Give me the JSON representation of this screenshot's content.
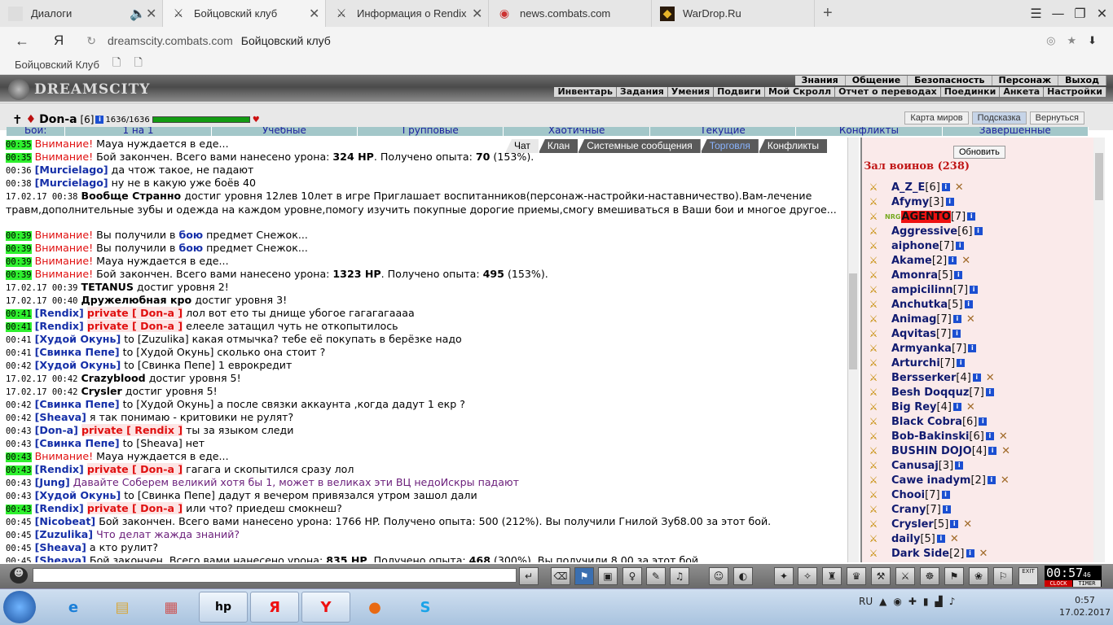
{
  "browser": {
    "tabs": [
      {
        "label": "Диалоги",
        "icon": "tab-icon",
        "closable": true,
        "extra": "speaker-icon"
      },
      {
        "label": "Бойцовский клуб",
        "icon": "crossed-swords-icon",
        "closable": true,
        "active": true
      },
      {
        "label": "Информация о Rendix",
        "icon": "crossed-swords-icon",
        "closable": true
      },
      {
        "label": "news.combats.com",
        "icon": "combats-icon",
        "closable": false
      },
      {
        "label": "WarDrop.Ru",
        "icon": "wardrop-icon",
        "closable": false
      }
    ],
    "new_tab": "+",
    "address": {
      "domain": "dreamscity.combats.com",
      "page_title": "Бойцовский клуб"
    },
    "bookmark_folder": "Бойцовский Клуб"
  },
  "game": {
    "logo": "DREAMSCITY",
    "top_menu": [
      "Знания",
      "Общение",
      "Безопасность",
      "Персонаж",
      "Выход"
    ],
    "sub_menu": [
      "Инвентарь",
      "Задания",
      "Умения",
      "Подвиги",
      "Мой Скролл",
      "Отчет о переводах",
      "Поединки",
      "Анкета",
      "Настройки"
    ],
    "character": {
      "name": "Don-a",
      "level": "[6]",
      "hp": "1636/1636"
    },
    "char_buttons": [
      "Карта миров",
      "Подсказка",
      "Вернуться"
    ],
    "fight_tabs": [
      "Бои:",
      "1 на 1",
      "Учебные",
      "Групповые",
      "Хаотичные",
      "Текущие",
      "Конфликты",
      "Завершенные"
    ],
    "chat_tabs": [
      "Чат",
      "Клан",
      "Системные сообщения",
      "Торговля",
      "Конфликты"
    ],
    "chat": [
      {
        "time": "00:35",
        "tclass": "g",
        "parts": [
          {
            "c": "warn",
            "t": "Внимание!"
          },
          {
            "c": "",
            "t": " Мауа нуждается в еде..."
          }
        ]
      },
      {
        "time": "00:35",
        "tclass": "g",
        "parts": [
          {
            "c": "warn",
            "t": "Внимание!"
          },
          {
            "c": "",
            "t": " Бой закончен. Всего вами нанесено урона: "
          },
          {
            "c": "b",
            "t": "324 HP"
          },
          {
            "c": "",
            "t": ". Получено опыта: "
          },
          {
            "c": "b",
            "t": "70"
          },
          {
            "c": "",
            "t": " (153%)."
          }
        ]
      },
      {
        "time": "00:36",
        "tclass": "",
        "parts": [
          {
            "c": "nick",
            "t": "[Murcielago]"
          },
          {
            "c": "",
            "t": " да чтож такое, не падают"
          }
        ]
      },
      {
        "time": "00:38",
        "tclass": "",
        "parts": [
          {
            "c": "nick",
            "t": "[Murcielago]"
          },
          {
            "c": "",
            "t": " ну не в какую уже боёв 40"
          }
        ]
      },
      {
        "time": "17.02.17 00:38",
        "tclass": "",
        "wrap": true,
        "parts": [
          {
            "c": "b",
            "t": "Вообще Странно"
          },
          {
            "c": "",
            "t": " достиг уровня 12лев 10лет в игре Приглашает воспитанников(персонаж-настройки-наставничество).Вам-лечение травм,дополнительные зубы и одежда на каждом уровне,помогу изучить покупные дорогие приемы,смогу вмешиваться в Ваши бои и многое другое..."
          }
        ]
      },
      {
        "time": "00:39",
        "tclass": "g",
        "parts": [
          {
            "c": "warn",
            "t": "Внимание!"
          },
          {
            "c": "",
            "t": " Вы получили в "
          },
          {
            "c": "nick",
            "t": "бою"
          },
          {
            "c": "",
            "t": " предмет Снежок..."
          }
        ]
      },
      {
        "time": "00:39",
        "tclass": "g",
        "parts": [
          {
            "c": "warn",
            "t": "Внимание!"
          },
          {
            "c": "",
            "t": " Вы получили в "
          },
          {
            "c": "nick",
            "t": "бою"
          },
          {
            "c": "",
            "t": " предмет Снежок..."
          }
        ]
      },
      {
        "time": "00:39",
        "tclass": "g",
        "parts": [
          {
            "c": "warn",
            "t": "Внимание!"
          },
          {
            "c": "",
            "t": " Мауа нуждается в еде..."
          }
        ]
      },
      {
        "time": "00:39",
        "tclass": "g",
        "parts": [
          {
            "c": "warn",
            "t": "Внимание!"
          },
          {
            "c": "",
            "t": " Бой закончен. Всего вами нанесено урона: "
          },
          {
            "c": "b",
            "t": "1323 HP"
          },
          {
            "c": "",
            "t": ". Получено опыта: "
          },
          {
            "c": "b",
            "t": "495"
          },
          {
            "c": "",
            "t": " (153%)."
          }
        ]
      },
      {
        "time": "17.02.17 00:39",
        "tclass": "",
        "parts": [
          {
            "c": "b",
            "t": "TETANUS"
          },
          {
            "c": "",
            "t": " достиг уровня 2!"
          }
        ]
      },
      {
        "time": "17.02.17 00:40",
        "tclass": "",
        "parts": [
          {
            "c": "b",
            "t": "Дружелюбная кро"
          },
          {
            "c": "",
            "t": " достиг уровня 3!"
          }
        ]
      },
      {
        "time": "00:41",
        "tclass": "g",
        "parts": [
          {
            "c": "nick",
            "t": "[Rendix]"
          },
          {
            "c": "",
            "t": " "
          },
          {
            "c": "priv",
            "t": "private [ Don-a ]"
          },
          {
            "c": "",
            "t": " лол вот ето ты днище убогое гагагагаааа"
          }
        ]
      },
      {
        "time": "00:41",
        "tclass": "g",
        "parts": [
          {
            "c": "nick",
            "t": "[Rendix]"
          },
          {
            "c": "",
            "t": " "
          },
          {
            "c": "priv",
            "t": "private [ Don-a ]"
          },
          {
            "c": "",
            "t": " елееле затащил чуть не откопытилось"
          }
        ]
      },
      {
        "time": "00:41",
        "tclass": "",
        "parts": [
          {
            "c": "nick",
            "t": "[Худой Окунь]"
          },
          {
            "c": "",
            "t": " to [Zuzulika] какая отмычка? тебе её покупать в берёзке надо"
          }
        ]
      },
      {
        "time": "00:41",
        "tclass": "",
        "parts": [
          {
            "c": "nick",
            "t": "[Свинка Пепе]"
          },
          {
            "c": "",
            "t": " to [Худой Окунь] сколько она стоит ?"
          }
        ]
      },
      {
        "time": "00:42",
        "tclass": "",
        "parts": [
          {
            "c": "nick",
            "t": "[Худой Окунь]"
          },
          {
            "c": "",
            "t": " to [Свинка Пепе] 1 еврокредит"
          }
        ]
      },
      {
        "time": "17.02.17 00:42",
        "tclass": "",
        "parts": [
          {
            "c": "b",
            "t": "Crazyblood"
          },
          {
            "c": "",
            "t": " достиг уровня 5!"
          }
        ]
      },
      {
        "time": "17.02.17 00:42",
        "tclass": "",
        "parts": [
          {
            "c": "b",
            "t": "Crysler"
          },
          {
            "c": "",
            "t": " достиг уровня 5!"
          }
        ]
      },
      {
        "time": "00:42",
        "tclass": "",
        "parts": [
          {
            "c": "nick",
            "t": "[Свинка Пепе]"
          },
          {
            "c": "",
            "t": " to [Худой Окунь] а после связки аккаунта ,когда дадут 1 екр ?"
          }
        ]
      },
      {
        "time": "00:42",
        "tclass": "",
        "parts": [
          {
            "c": "nick",
            "t": "[Sheava]"
          },
          {
            "c": "",
            "t": " я так понимаю - критовики не рулят?"
          }
        ]
      },
      {
        "time": "00:43",
        "tclass": "",
        "parts": [
          {
            "c": "nick",
            "t": "[Don-a]"
          },
          {
            "c": "",
            "t": " "
          },
          {
            "c": "priv",
            "t": "private [ Rendix ]"
          },
          {
            "c": "",
            "t": " ты за языком следи"
          }
        ]
      },
      {
        "time": "00:43",
        "tclass": "",
        "parts": [
          {
            "c": "nick",
            "t": "[Свинка Пепе]"
          },
          {
            "c": "",
            "t": " to [Sheava] нет"
          }
        ]
      },
      {
        "time": "00:43",
        "tclass": "g",
        "parts": [
          {
            "c": "warn",
            "t": "Внимание!"
          },
          {
            "c": "",
            "t": " Мауа нуждается в еде..."
          }
        ]
      },
      {
        "time": "00:43",
        "tclass": "g",
        "parts": [
          {
            "c": "nick",
            "t": "[Rendix]"
          },
          {
            "c": "",
            "t": " "
          },
          {
            "c": "priv",
            "t": "private [ Don-a ]"
          },
          {
            "c": "",
            "t": " гагага и скопытился сразу лол"
          }
        ]
      },
      {
        "time": "00:43",
        "tclass": "",
        "parts": [
          {
            "c": "nick",
            "t": "[Jung]"
          },
          {
            "c": "",
            "t": " "
          },
          {
            "c": "purp",
            "t": "Давайте Соберем великий хотя бы 1, может в великах эти ВЦ недоИскры падают"
          }
        ]
      },
      {
        "time": "00:43",
        "tclass": "",
        "parts": [
          {
            "c": "nick",
            "t": "[Худой Окунь]"
          },
          {
            "c": "",
            "t": " to [Свинка Пепе] дадут я вечером привязался утром зашол дали"
          }
        ]
      },
      {
        "time": "00:43",
        "tclass": "g",
        "parts": [
          {
            "c": "nick",
            "t": "[Rendix]"
          },
          {
            "c": "",
            "t": " "
          },
          {
            "c": "priv",
            "t": "private [ Don-a ]"
          },
          {
            "c": "",
            "t": " или что? приедеш смокнеш?"
          }
        ]
      },
      {
        "time": "00:45",
        "tclass": "",
        "parts": [
          {
            "c": "nick",
            "t": "[Nicobeat]"
          },
          {
            "c": "",
            "t": " Бой закончен. Всего вами нанесено урона: 1766 HP. Получено опыта: 500 (212%). Вы получили Гнилой Зуб8.00 за этот бой."
          }
        ]
      },
      {
        "time": "00:45",
        "tclass": "",
        "parts": [
          {
            "c": "nick",
            "t": "[Zuzulika]"
          },
          {
            "c": "",
            "t": " "
          },
          {
            "c": "purp",
            "t": "Что делат жажда знаний?"
          }
        ]
      },
      {
        "time": "00:45",
        "tclass": "",
        "parts": [
          {
            "c": "nick",
            "t": "[Sheava]"
          },
          {
            "c": "",
            "t": " а кто рулит?"
          }
        ]
      },
      {
        "time": "00:45",
        "tclass": "",
        "parts": [
          {
            "c": "nick",
            "t": "[Sheava]"
          },
          {
            "c": "",
            "t": " Бой закончен. Всего вами нанесено урона: "
          },
          {
            "c": "b",
            "t": "835 HP"
          },
          {
            "c": "",
            "t": ". Получено опыта: "
          },
          {
            "c": "b",
            "t": "468"
          },
          {
            "c": "",
            "t": " (300%). Вы получили 8.00 за этот бой."
          }
        ]
      }
    ],
    "hall": {
      "refresh": "Обновить",
      "title": "Зал воинов (238)",
      "players": [
        {
          "name": "A_Z_E",
          "lv": "[6]",
          "x": true
        },
        {
          "name": "Afymy",
          "lv": "[3]",
          "x": false
        },
        {
          "name": "AGENTO",
          "lv": "[7]",
          "x": false,
          "hl": true,
          "prefix": "NRG"
        },
        {
          "name": "Aggressive",
          "lv": "[6]",
          "x": false
        },
        {
          "name": "aiphone",
          "lv": "[7]",
          "x": false
        },
        {
          "name": "Akame",
          "lv": "[2]",
          "x": true
        },
        {
          "name": "Amonra",
          "lv": "[5]",
          "x": false
        },
        {
          "name": "ampicilinn",
          "lv": "[7]",
          "x": false
        },
        {
          "name": "Anchutka",
          "lv": "[5]",
          "x": false
        },
        {
          "name": "Animag",
          "lv": "[7]",
          "x": true
        },
        {
          "name": "Aqvitas",
          "lv": "[7]",
          "x": false
        },
        {
          "name": "Armyanka",
          "lv": "[7]",
          "x": false
        },
        {
          "name": "Arturchi",
          "lv": "[7]",
          "x": false
        },
        {
          "name": "Bersserker",
          "lv": "[4]",
          "x": true
        },
        {
          "name": "Besh Doqquz",
          "lv": "[7]",
          "x": false
        },
        {
          "name": "Big Rey",
          "lv": "[4]",
          "x": true
        },
        {
          "name": "Black Cobra",
          "lv": "[6]",
          "x": false
        },
        {
          "name": "Bob-Bakinski",
          "lv": "[6]",
          "x": true
        },
        {
          "name": "BUSHIN DOJO",
          "lv": "[4]",
          "x": true
        },
        {
          "name": "Canusaj",
          "lv": "[3]",
          "x": false
        },
        {
          "name": "Cawe inadym",
          "lv": "[2]",
          "x": true
        },
        {
          "name": "Chooi",
          "lv": "[7]",
          "x": false
        },
        {
          "name": "Crany",
          "lv": "[7]",
          "x": false
        },
        {
          "name": "Crysler",
          "lv": "[5]",
          "x": true
        },
        {
          "name": "daily",
          "lv": "[5]",
          "x": true
        },
        {
          "name": "Dark Side",
          "lv": "[2]",
          "x": true
        }
      ]
    },
    "timer": {
      "time": "00:57",
      "sec": "46",
      "clock_label": "CLOCK",
      "timer_label": "TIMER",
      "exit": "EXIT"
    }
  },
  "taskbar": {
    "lang": "RU",
    "time": "0:57",
    "date": "17.02.2017"
  }
}
